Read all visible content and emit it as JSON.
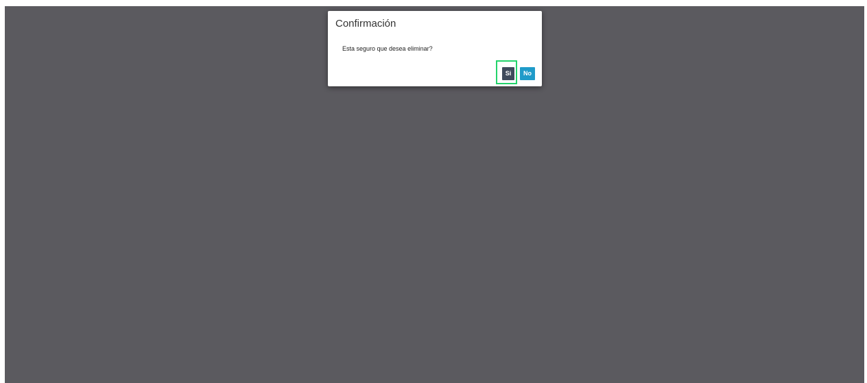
{
  "dialog": {
    "title": "Confirmación",
    "message": "Esta seguro que desea eliminar?",
    "buttons": {
      "yes_label": "Si",
      "no_label": "No"
    }
  },
  "colors": {
    "overlay": "#5b5a5f",
    "yes_button": "#3f4a5c",
    "no_button": "#1f9bc9",
    "focus_highlight": "#22d36a"
  }
}
